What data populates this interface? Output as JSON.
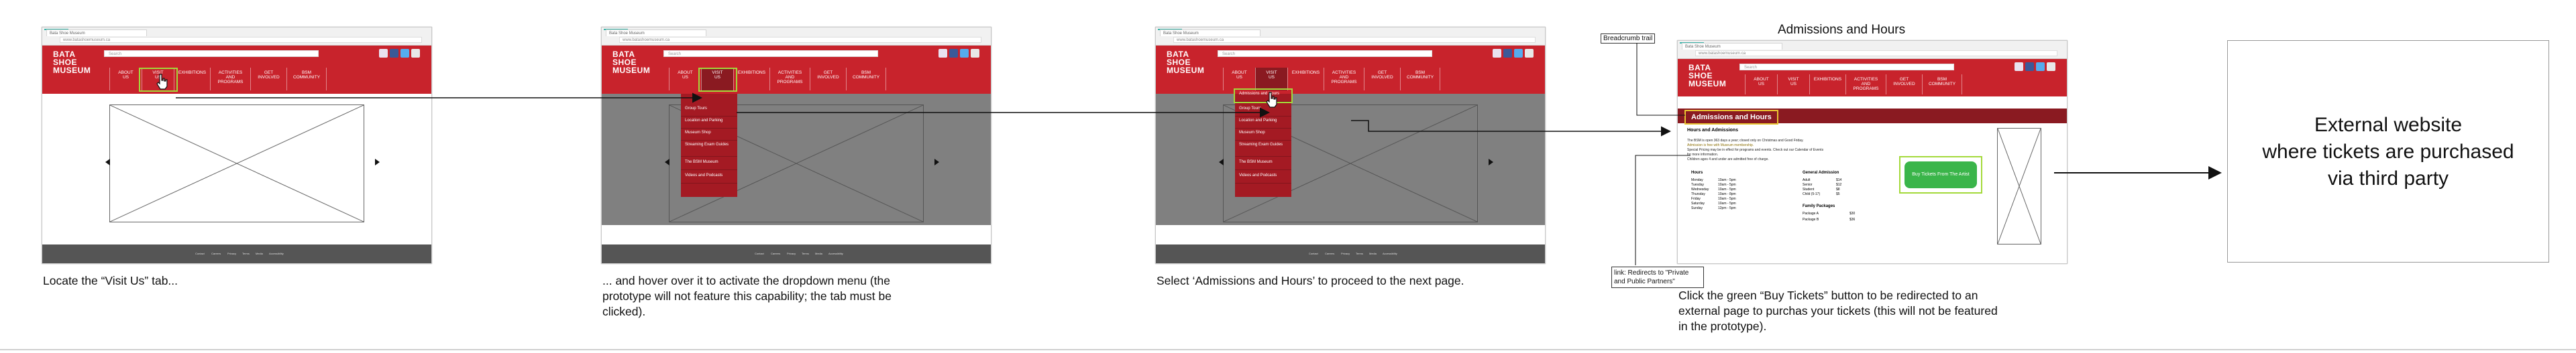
{
  "site": {
    "tab_label": "Bata Shoe Museum",
    "address": "www.batashoemuseum.ca",
    "logo_lines": [
      "BATA",
      "SHOE",
      "MUSEUM"
    ],
    "search_placeholder": "Search",
    "social_icons": [
      "instagram-icon",
      "facebook-icon",
      "twitter-icon",
      "email-icon"
    ],
    "nav": [
      {
        "lines": [
          "ABOUT",
          "US"
        ]
      },
      {
        "lines": [
          "VISIT",
          "US"
        ]
      },
      {
        "lines": [
          "EXHIBITIONS"
        ]
      },
      {
        "lines": [
          "ACTIVITIES",
          "AND",
          "PROGRAMS"
        ]
      },
      {
        "lines": [
          "GET",
          "INVOLVED"
        ]
      },
      {
        "lines": [
          "BSM",
          "COMMUNITY"
        ]
      }
    ],
    "footer_links": [
      "Contact",
      "Careers",
      "Privacy",
      "Terms",
      "Media",
      "Accessibility"
    ]
  },
  "dropdown_items": [
    "Admissions and Hours",
    "Group Tours",
    "Location and Parking",
    "Museum Shop",
    "Streaming Exam Guides",
    "The BSM Museum",
    "Videos and Podcasts"
  ],
  "step4": {
    "title": "Admissions and Hours",
    "breadcrumb_label": "Breadcrumb trail",
    "page_bar_title": "Admissions and Hours",
    "section_heading": "Hours and Admissions",
    "intro_lines": [
      "The BSM is open 363 days a year; closed only on Christmas and Good Friday.",
      "Admission is free with Museum membership.",
      "Special Pricing may be in effect for programs and events. Check out our Calendar of Events",
      "for more information.",
      "Children ages 4 and under are admitted free of charge."
    ],
    "hours_heading": "Hours",
    "hours": [
      [
        "Monday",
        "10am - 5pm"
      ],
      [
        "Tuesday",
        "10am - 5pm"
      ],
      [
        "Wednesday",
        "10am - 5pm"
      ],
      [
        "Thursday",
        "10am - 8pm"
      ],
      [
        "Friday",
        "10am - 5pm"
      ],
      [
        "Saturday",
        "10am - 5pm"
      ],
      [
        "Sunday",
        "12pm - 5pm"
      ]
    ],
    "admission_heading": "General Admission",
    "admission_rows": [
      [
        "Adult",
        "$14"
      ],
      [
        "Senior",
        "$12"
      ],
      [
        "Student",
        "$8"
      ],
      [
        "Child (5-17)",
        "$5"
      ]
    ],
    "family_heading": "Family Packages",
    "family_rows": [
      [
        "Package A",
        "$30"
      ],
      [
        "Package B",
        "$36"
      ]
    ],
    "buy_button": "Buy Tickets From The Artist",
    "link_note": "link: Redirects to \"Private and Public Partners\""
  },
  "external_box": {
    "lines": [
      "External website",
      "where tickets are purchased",
      "via third party"
    ]
  },
  "captions": [
    [
      "Locate the “Visit Us” tab..."
    ],
    [
      "... and hover over it to activate the dropdown menu (the",
      "prototype will not feature this capability; the tab must be",
      "clicked)."
    ],
    [
      "Select ‘Admissions and Hours’ to proceed to the next page."
    ],
    [
      "Click the green “Buy Tickets” button to be redirected to an",
      "external page to purchas your tickets (this will not be featured",
      "in the prototype)."
    ]
  ],
  "colors": {
    "header_red": "#c8232c",
    "dark_red": "#8a1a21",
    "highlight_green": "#a3d93a",
    "button_green": "#3ab54a",
    "gray_overlay": "#808080",
    "footer_gray": "#555555"
  }
}
